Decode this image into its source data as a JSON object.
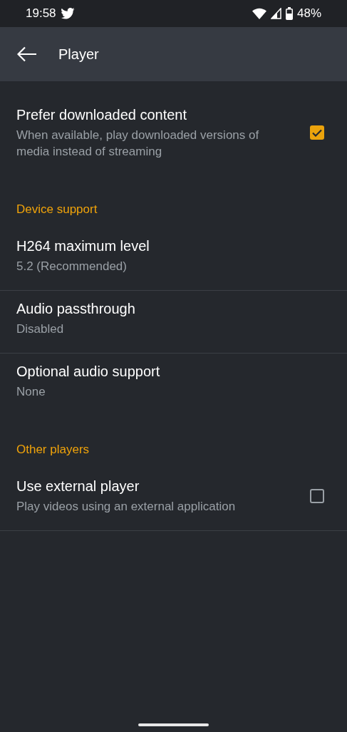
{
  "status_bar": {
    "time": "19:58",
    "battery": "48%"
  },
  "toolbar": {
    "title": "Player"
  },
  "items": [
    {
      "kind": "checkbox",
      "title": "Prefer downloaded content",
      "summary": "When available, play downloaded versions of media instead of streaming",
      "checked": true
    },
    {
      "kind": "header",
      "title": "Device support"
    },
    {
      "kind": "option",
      "title": "H264 maximum level",
      "summary": "5.2 (Recommended)"
    },
    {
      "kind": "option",
      "title": "Audio passthrough",
      "summary": "Disabled"
    },
    {
      "kind": "option",
      "title": "Optional audio support",
      "summary": "None"
    },
    {
      "kind": "header",
      "title": "Other players"
    },
    {
      "kind": "checkbox",
      "title": "Use external player",
      "summary": "Play videos using an external application",
      "checked": false
    }
  ]
}
